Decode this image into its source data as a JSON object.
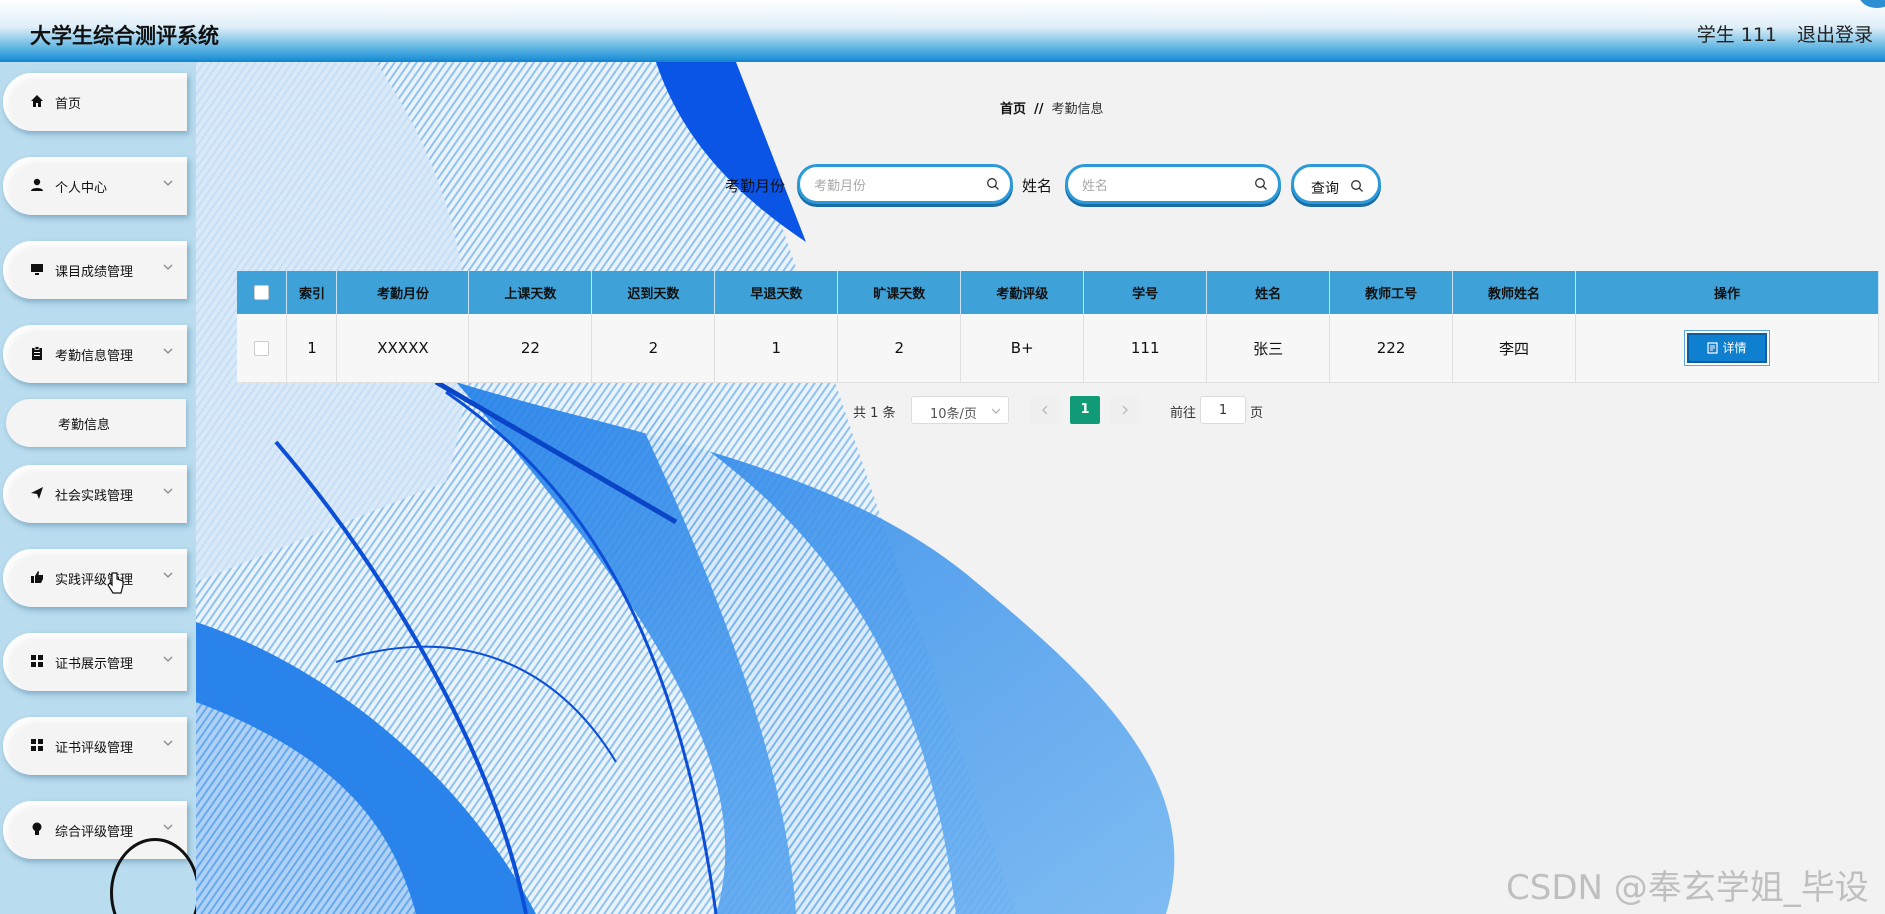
{
  "header": {
    "title": "大学生综合测评系统",
    "user": "学生 111",
    "logout": "退出登录"
  },
  "sidebar": {
    "items": [
      {
        "label": "首页",
        "icon": "home-icon",
        "has_children": false
      },
      {
        "label": "个人中心",
        "icon": "user-icon",
        "has_children": true
      },
      {
        "label": "课目成绩管理",
        "icon": "monitor-icon",
        "has_children": true
      },
      {
        "label": "考勤信息管理",
        "icon": "clipboard-icon",
        "has_children": true
      },
      {
        "label": "社会实践管理",
        "icon": "send-icon",
        "has_children": true
      },
      {
        "label": "实践评级管理",
        "icon": "thumbs-up-icon",
        "has_children": true
      },
      {
        "label": "证书展示管理",
        "icon": "grid-icon",
        "has_children": true
      },
      {
        "label": "证书评级管理",
        "icon": "grid-icon",
        "has_children": true
      },
      {
        "label": "综合评级管理",
        "icon": "lightbulb-icon",
        "has_children": true
      }
    ],
    "sub_item": "考勤信息"
  },
  "breadcrumb": {
    "home": "首页",
    "separator": "//",
    "current": "考勤信息"
  },
  "search": {
    "month_label": "考勤月份",
    "month_placeholder": "考勤月份",
    "name_label": "姓名",
    "name_placeholder": "姓名",
    "query_label": "查询"
  },
  "table": {
    "headers": [
      "索引",
      "考勤月份",
      "上课天数",
      "迟到天数",
      "早退天数",
      "旷课天数",
      "考勤评级",
      "学号",
      "姓名",
      "教师工号",
      "教师姓名",
      "操作"
    ],
    "rows": [
      {
        "index": "1",
        "month": "XXXXX",
        "class_days": "22",
        "late_days": "2",
        "early_leave_days": "1",
        "absent_days": "2",
        "grade": "B+",
        "student_id": "111",
        "name": "张三",
        "teacher_id": "222",
        "teacher_name": "李四",
        "action": "详情"
      }
    ]
  },
  "pagination": {
    "total": "共 1 条",
    "page_size": "10条/页",
    "current_page": "1",
    "goto_label": "前往",
    "goto_value": "1",
    "page_suffix": "页"
  },
  "watermark": "CSDN @奉玄学姐_毕设",
  "colors": {
    "accent": "#3ea1d8",
    "header_blue": "#1c8fd8",
    "sidebar_bg": "#b9dcee",
    "page_active": "#119a76",
    "detail_button": "#0f7fd0"
  }
}
